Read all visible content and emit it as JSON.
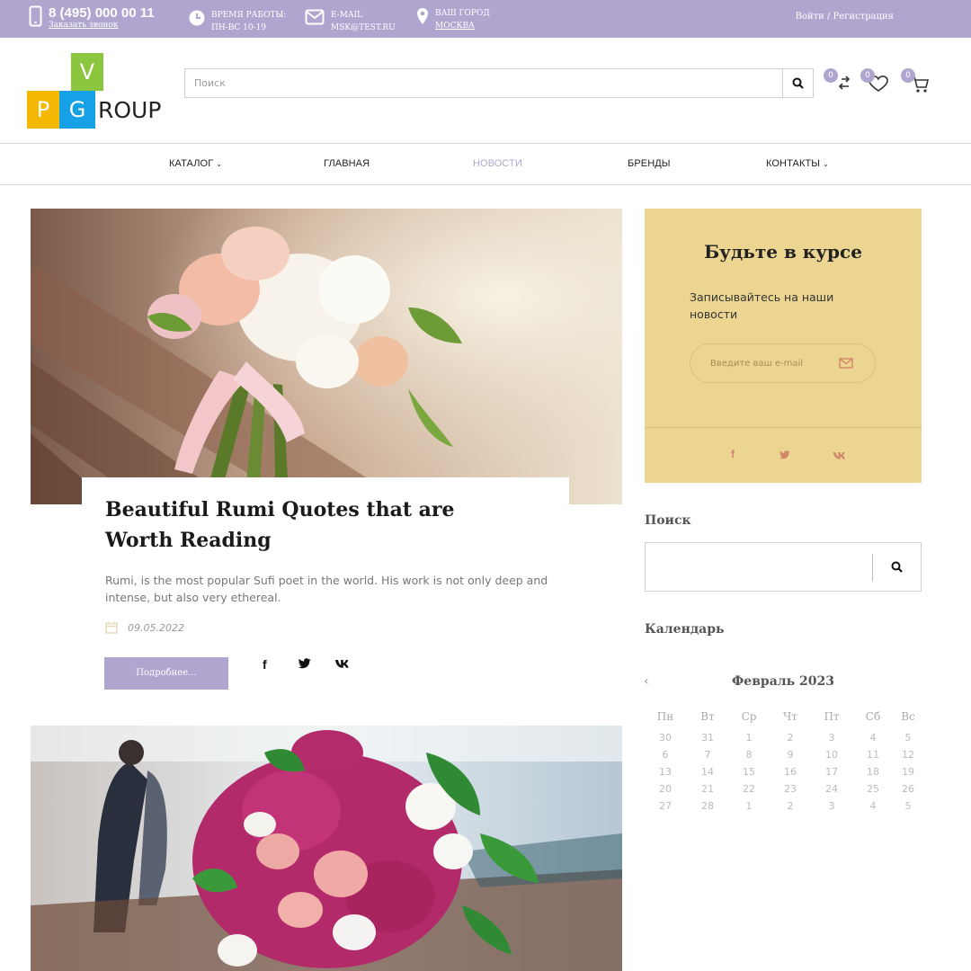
{
  "topbar": {
    "phone": "8 (495) 000 00 11",
    "callback": "Заказать звонок",
    "hours_label": "Время работы:",
    "hours_value": "ПН-ВС 10-19",
    "email_label": "E-MAIL",
    "email_value": "MSK@TEST.RU",
    "city_label": "Ваш город",
    "city_value": "Москва",
    "login": "Войти / Регистрация"
  },
  "logo": {
    "v": "V",
    "p": "P",
    "g": "G",
    "roup": "ROUP"
  },
  "header": {
    "search_placeholder": "Поиск",
    "compare_count": "0",
    "wishlist_count": "0",
    "cart_count": "0"
  },
  "nav": [
    {
      "label": "КАТАЛОГ",
      "caret": true
    },
    {
      "label": "ГЛАВНАЯ",
      "caret": false
    },
    {
      "label": "НОВОСТИ",
      "caret": false,
      "active": true
    },
    {
      "label": "БРЕНДЫ",
      "caret": false
    },
    {
      "label": "КОНТАКТЫ",
      "caret": true
    }
  ],
  "post": {
    "title": "Beautiful Rumi Quotes that are Worth Reading",
    "excerpt": "Rumi, is the most popular Sufi poet in the world. His work is not only deep and intense, but also very ethereal.",
    "date": "09.05.2022",
    "more_label": "Подробнее..."
  },
  "subscribe": {
    "title": "Будьте в курсе",
    "text": "Записывайтесь на наши новости",
    "placeholder": "Введите ваш e-mail"
  },
  "sidebar": {
    "search_heading": "Поиск",
    "calendar_heading": "Календарь"
  },
  "calendar": {
    "prev": "‹",
    "title": "Февраль 2023",
    "weekdays": [
      "Пн",
      "Вт",
      "Ср",
      "Чт",
      "Пт",
      "Сб",
      "Вс"
    ],
    "weeks": [
      [
        "30",
        "31",
        "1",
        "2",
        "3",
        "4",
        "5"
      ],
      [
        "6",
        "7",
        "8",
        "9",
        "10",
        "11",
        "12"
      ],
      [
        "13",
        "14",
        "15",
        "16",
        "17",
        "18",
        "19"
      ],
      [
        "20",
        "21",
        "22",
        "23",
        "24",
        "25",
        "26"
      ],
      [
        "27",
        "28",
        "1",
        "2",
        "3",
        "4",
        "5"
      ]
    ]
  },
  "colors": {
    "accent": "#b0a5cf",
    "subscribe_bg": "#ecd591",
    "social_accent": "#d0876b"
  },
  "icons": [
    "phone-icon",
    "clock-icon",
    "mail-icon",
    "location-pin-icon",
    "search-icon",
    "compare-icon",
    "heart-icon",
    "cart-icon",
    "calendar-icon",
    "facebook-icon",
    "twitter-icon",
    "vk-icon",
    "envelope-icon"
  ]
}
